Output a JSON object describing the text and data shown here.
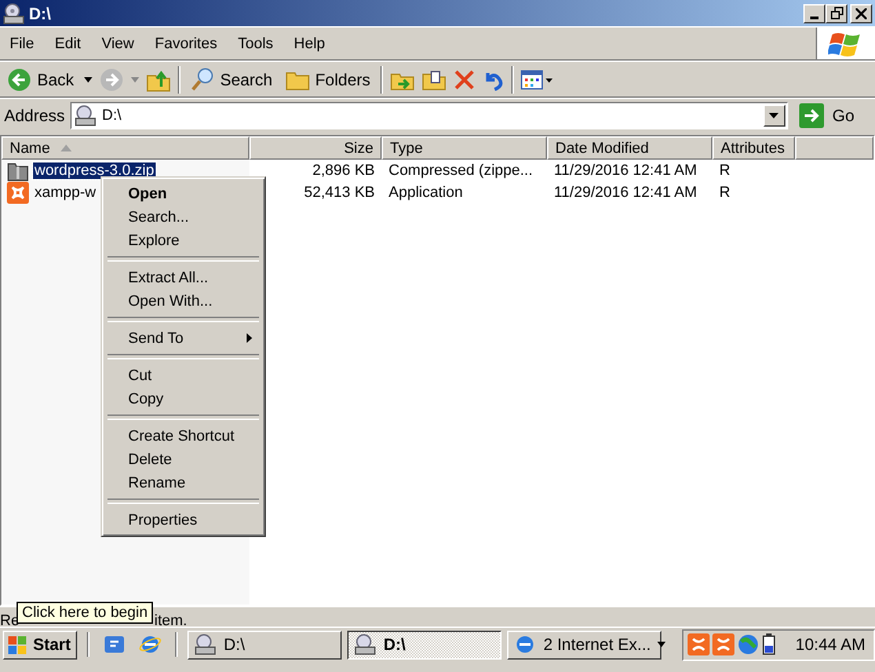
{
  "window": {
    "title": "D:\\"
  },
  "menu_bar": [
    "File",
    "Edit",
    "View",
    "Favorites",
    "Tools",
    "Help"
  ],
  "toolbar": {
    "back": "Back",
    "search": "Search",
    "folders": "Folders"
  },
  "address": {
    "label": "Address",
    "value": "D:\\",
    "go": "Go"
  },
  "table": {
    "columns": [
      {
        "label": "Name",
        "sorted": true
      },
      {
        "label": "Size",
        "sorted": false
      },
      {
        "label": "Type",
        "sorted": false
      },
      {
        "label": "Date Modified",
        "sorted": false
      },
      {
        "label": "Attributes",
        "sorted": false
      }
    ],
    "rows": [
      {
        "kind": "zip",
        "name": "wordpress-3.0.zip",
        "size": "2,896 KB",
        "type": "Compressed (zippe...",
        "date": "11/29/2016 12:41 AM",
        "attributes": "R",
        "selected": true
      },
      {
        "kind": "app",
        "name": "xampp-w",
        "size": "52,413 KB",
        "type": "Application",
        "date": "11/29/2016 12:41 AM",
        "attributes": "R",
        "selected": false
      }
    ]
  },
  "context_menu": [
    {
      "kind": "item",
      "label": "Open",
      "default": true
    },
    {
      "kind": "item",
      "label": "Search...",
      "default": false
    },
    {
      "kind": "item",
      "label": "Explore",
      "default": false
    },
    {
      "kind": "separator"
    },
    {
      "kind": "item",
      "label": "Extract All...",
      "default": false
    },
    {
      "kind": "item",
      "label": "Open With...",
      "default": false
    },
    {
      "kind": "separator"
    },
    {
      "kind": "submenu",
      "label": "Send To",
      "default": false
    },
    {
      "kind": "separator"
    },
    {
      "kind": "item",
      "label": "Cut",
      "default": false
    },
    {
      "kind": "item",
      "label": "Copy",
      "default": false
    },
    {
      "kind": "separator"
    },
    {
      "kind": "item",
      "label": "Create Shortcut",
      "default": false
    },
    {
      "kind": "item",
      "label": "Delete",
      "default": false
    },
    {
      "kind": "item",
      "label": "Rename",
      "default": false
    },
    {
      "kind": "separator"
    },
    {
      "kind": "item",
      "label": "Properties",
      "default": false
    }
  ],
  "status_bar": [
    "Re",
    "item."
  ],
  "tooltip": "Click here to begin",
  "taskbar": {
    "start": "Start",
    "tasks": [
      {
        "kind": "drive",
        "label": "D:\\",
        "selected": false
      },
      {
        "kind": "drive",
        "label": "D:\\",
        "selected": true
      },
      {
        "kind": "browser",
        "label": "2 Internet Ex...",
        "selected": false
      }
    ],
    "clock": "10:44 AM"
  }
}
